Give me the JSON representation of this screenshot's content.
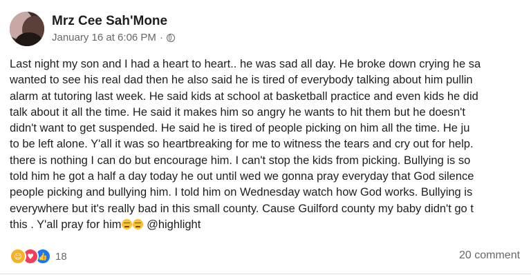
{
  "post": {
    "author_name": "Mrz Cee Sah'Mone",
    "date": "January 16 at 6:06 PM",
    "separator": "·",
    "privacy_icon": "globe-icon",
    "text_lines": [
      "Last night my son and I had a heart to heart.. he was sad all day. He broke down crying he sa",
      "wanted to see his real dad then he also said he is tired of everybody talking about him pullin",
      "alarm at tutoring last week. He said kids at school at basketball practice and even kids he did",
      "talk about it all the time. He said it makes him so angry he wants to hit them but he doesn't",
      "didn't want to get suspended. He said he is tired of people picking on him all the time. He ju",
      "to be left alone. Y'all it was so heartbreaking for me to witness the tears and cry out for help.",
      "there is nothing I can do but encourage him. I can't stop the kids from picking. Bullying is so",
      "told him he got a half a day today he out until wed we gonna pray everyday that God silence",
      "people picking and bullying him. I told him on Wednesday watch how God works. Bullying is",
      "everywhere but it's really bad in this small county. Cause Guilford county my baby didn't go t",
      "this . Y'all pray for him"
    ],
    "mention": "@highlight",
    "emoji_icon": "tired-face-emoji"
  },
  "reactions": {
    "icons": [
      "care-reaction-icon",
      "love-reaction-icon",
      "like-reaction-icon"
    ],
    "count": "18"
  },
  "comments": {
    "label": "20 comment"
  },
  "colors": {
    "primary_text": "#1c1e21",
    "secondary_text": "#65676b",
    "like_blue": "#1877f2",
    "love_red": "#f33e58",
    "care_yellow": "#f7b125"
  }
}
